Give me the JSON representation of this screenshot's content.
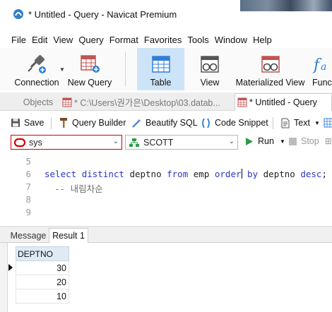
{
  "window": {
    "title": "* Untitled - Query - Navicat Premium"
  },
  "menu": [
    "File",
    "Edit",
    "View",
    "Query",
    "Format",
    "Favorites",
    "Tools",
    "Window",
    "Help"
  ],
  "toolbar": {
    "connection": "Connection",
    "new_query": "New Query",
    "table": "Table",
    "view": "View",
    "materialized_view": "Materialized View",
    "function_partial": "Func"
  },
  "tabs": {
    "objects": "Objects",
    "file_tab": "* C:\\Users\\권가은\\Desktop\\03.datab...",
    "query_tab": "* Untitled - Query"
  },
  "query_toolbar": {
    "save": "Save",
    "query_builder": "Query Builder",
    "beautify": "Beautify SQL",
    "snippet": "Code Snippet",
    "text": "Text"
  },
  "connection_bar": {
    "connection_value": "sys",
    "schema_value": "SCOTT",
    "run": "Run",
    "stop": "Stop"
  },
  "editor": {
    "line_numbers": [
      "5",
      "6",
      "7",
      "8",
      "9"
    ],
    "sql_keywords": [
      "select",
      "distinct",
      "from",
      "order",
      "by",
      "desc"
    ],
    "sql_tokens": {
      "col": "deptno",
      "table": "emp",
      "end": ";"
    },
    "comment": "-- 내림차순"
  },
  "results": {
    "tabs": [
      "Message",
      "Result 1"
    ],
    "column": "DEPTNO",
    "rows": [
      "30",
      "20",
      "10"
    ]
  },
  "colors": {
    "keyword": "#2a36c8",
    "active_toolbar": "#cde3f7",
    "grid_header": "#dfeaf6"
  }
}
